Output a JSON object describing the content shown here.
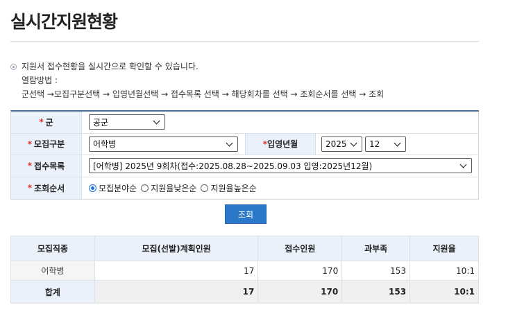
{
  "page": {
    "title": "실시간지원현황"
  },
  "info": {
    "line1": "지원서 접수현황을 실시간으로 확인할 수 있습니다.",
    "line2": "열람방법 :",
    "line3": "군선택 →모집구분선택 → 입영년월선택 → 접수목록 선택 → 해당회차를 선택 → 조회순서를 선택 → 조회"
  },
  "form": {
    "branch": {
      "label": "군",
      "value": "공군"
    },
    "category": {
      "label": "모집구분",
      "value": "어학병"
    },
    "enlist": {
      "label": "*입영년월",
      "year": "2025",
      "month": "12"
    },
    "round": {
      "label": "접수목록",
      "value": "[어학병] 2025년 9회차(접수:2025.08.28~2025.09.03 입영:2025년12월)"
    },
    "order": {
      "label": "조회순서",
      "options": [
        "모집분야순",
        "지원율낮은순",
        "지원율높은순"
      ],
      "selected_index": 0
    },
    "search_label": "조회"
  },
  "table": {
    "headers": [
      "모집직종",
      "모집(선발)계획인원",
      "접수인원",
      "과부족",
      "지원율"
    ],
    "rows": [
      [
        "어학병",
        "17",
        "170",
        "153",
        "10:1"
      ]
    ],
    "total": [
      "합계",
      "17",
      "170",
      "153",
      "10:1"
    ]
  },
  "colors": {
    "accent": "#2b78c8",
    "header_bg": "#eaf1fa",
    "required": "#e0322b"
  }
}
